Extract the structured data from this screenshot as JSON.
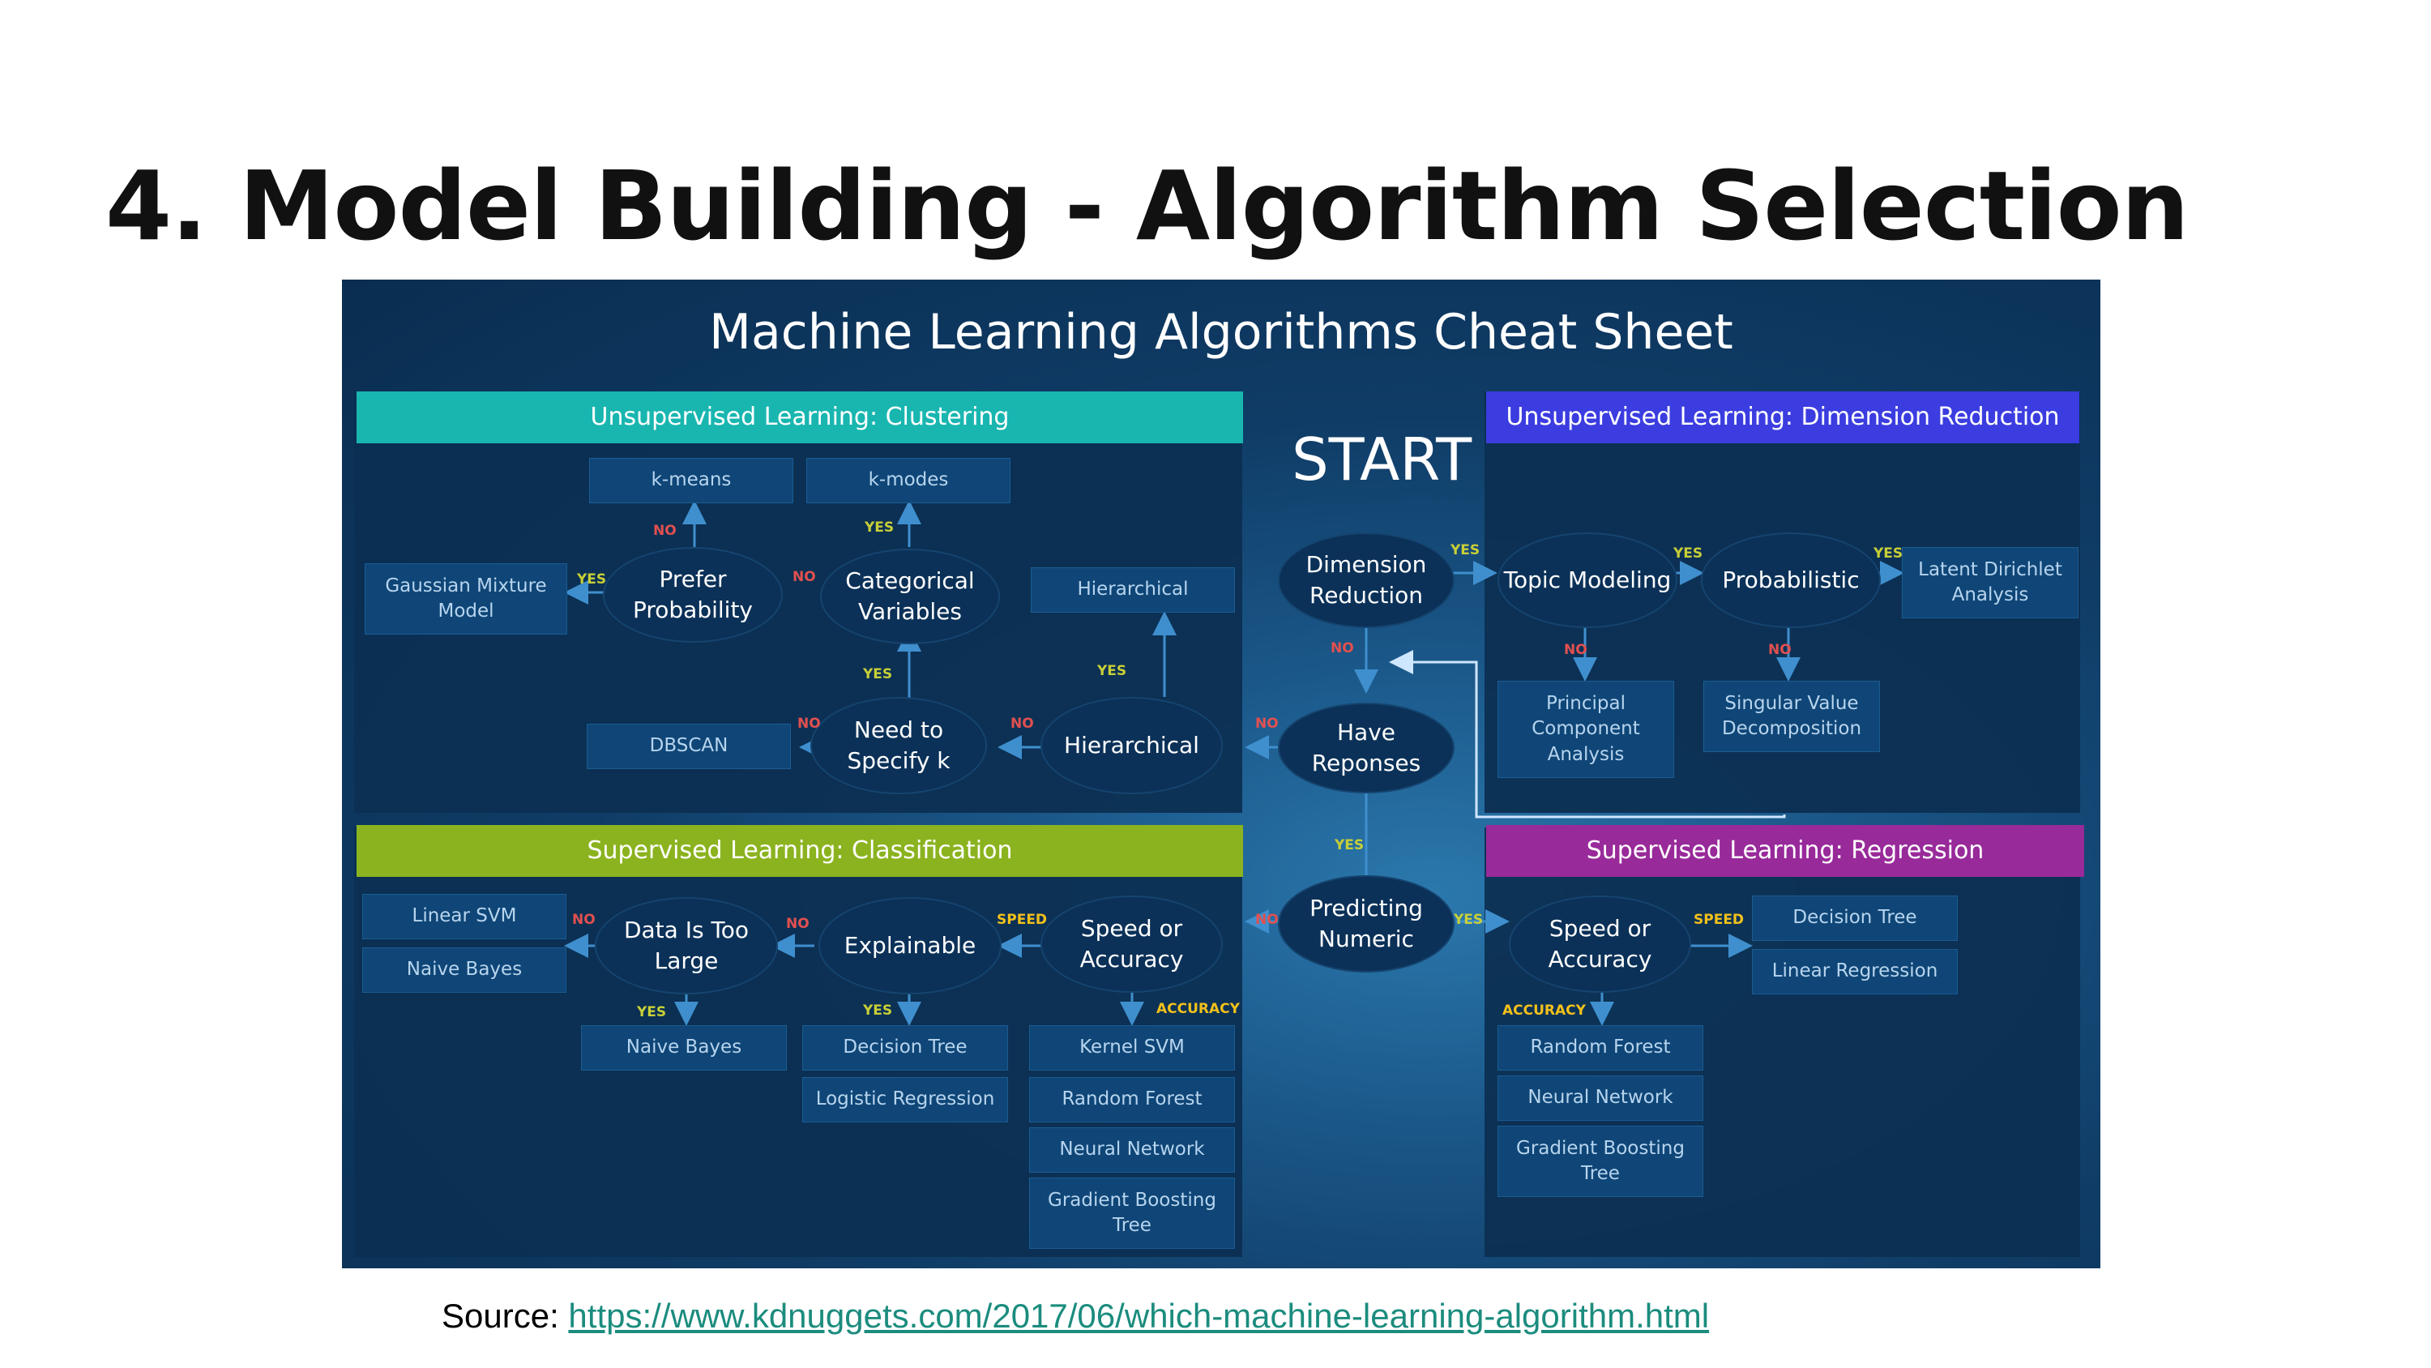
{
  "slide": {
    "title": "4. Model Building - Algorithm Selection",
    "source_label": "Source:",
    "source_url": "https://www.kdnuggets.com/2017/06/which-machine-learning-algorithm.html"
  },
  "cheat_sheet": {
    "title": "Machine Learning Algorithms Cheat Sheet",
    "start": "START",
    "headers": {
      "clustering": "Unsupervised Learning: Clustering",
      "dimension_reduction": "Unsupervised Learning: Dimension Reduction",
      "classification": "Supervised Learning: Classification",
      "regression": "Supervised Learning: Regression"
    },
    "header_colors": {
      "clustering": "#19b6b0",
      "dimension_reduction": "#3b3de0",
      "classification": "#8bb31f",
      "regression": "#982a9a"
    },
    "center": {
      "dimension_reduction": "Dimension Reduction",
      "have_responses": "Have Reponses",
      "predicting_numeric": "Predicting Numeric"
    },
    "clustering": {
      "k_means": "k-means",
      "k_modes": "k-modes",
      "gaussian": "Gaussian Mixture Model",
      "prefer_probability": "Prefer Probability",
      "categorical_variables": "Categorical Variables",
      "hierarchical_box": "Hierarchical",
      "dbscan": "DBSCAN",
      "need_to_specify_k": "Need to Specify k",
      "hierarchical_node": "Hierarchical"
    },
    "dimension": {
      "topic_modeling": "Topic Modeling",
      "probabilistic": "Probabilistic",
      "lda": "Latent Dirichlet Analysis",
      "pca": "Principal Component Analysis",
      "svd": "Singular Value Decomposition"
    },
    "classification": {
      "linear_svm": "Linear SVM",
      "naive_bayes_top": "Naive Bayes",
      "data_too_large": "Data Is Too Large",
      "explainable": "Explainable",
      "speed_or_accuracy": "Speed or Accuracy",
      "naive_bayes": "Naive Bayes",
      "decision_tree": "Decision Tree",
      "logistic_regression": "Logistic Regression",
      "kernel_svm": "Kernel SVM",
      "random_forest": "Random Forest",
      "neural_network": "Neural Network",
      "gradient_boosting": "Gradient Boosting Tree"
    },
    "regression": {
      "speed_or_accuracy": "Speed or Accuracy",
      "decision_tree": "Decision Tree",
      "linear_regression": "Linear Regression",
      "random_forest": "Random Forest",
      "neural_network": "Neural Network",
      "gradient_boosting": "Gradient Boosting Tree"
    },
    "edge_labels": {
      "yes": "YES",
      "no": "NO",
      "speed": "SPEED",
      "accuracy": "ACCURACY"
    }
  }
}
